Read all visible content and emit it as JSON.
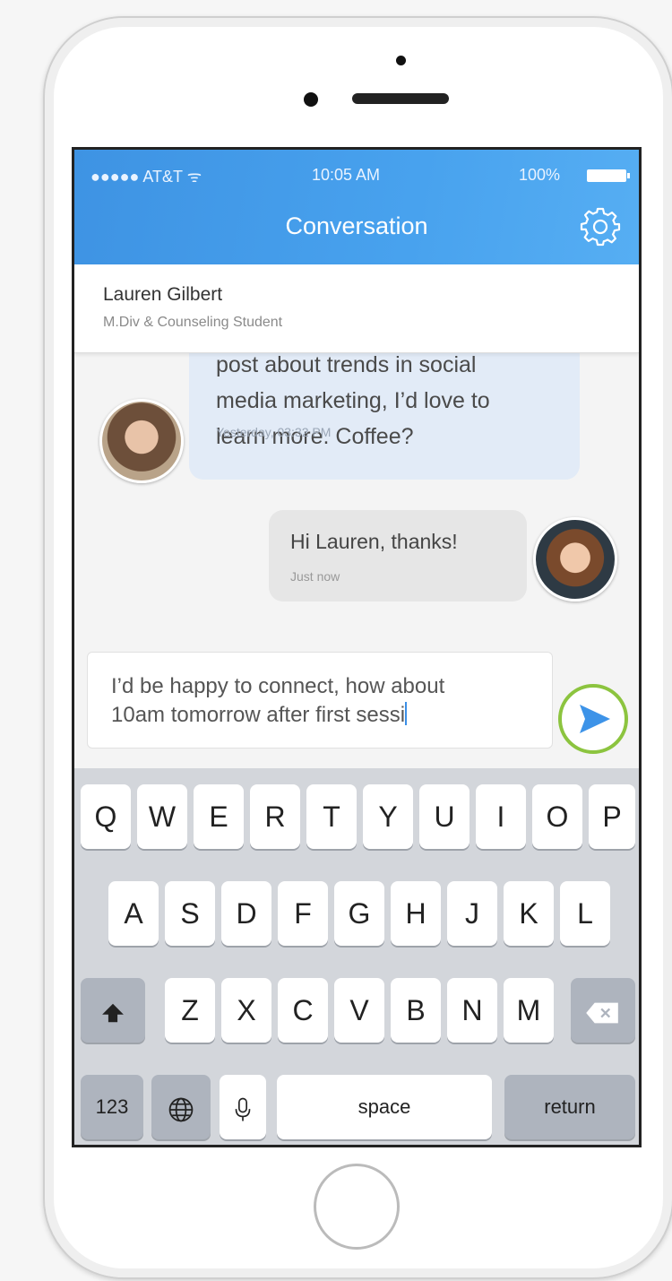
{
  "status_bar": {
    "carrier": "●●●●● AT&T ᯤ",
    "time": "10:05 AM",
    "battery": "100%"
  },
  "nav": {
    "title": "Conversation",
    "settings_icon": "gear-icon"
  },
  "contact": {
    "name": "Lauren Gilbert",
    "subtitle": "M.Div & Counseling Student"
  },
  "messages": [
    {
      "sender": "Lauren Gilbert",
      "text_lines": [
        "post about trends in social",
        "media marketing, I’d love to",
        "learn more. Coffee?"
      ],
      "timestamp": "Yesterday, 03:32 PM"
    },
    {
      "sender": "me",
      "text": "Hi Lauren, thanks!",
      "timestamp": "Just now"
    }
  ],
  "composer": {
    "line1": "I’d be happy to connect, how about",
    "line2": "10am tomorrow after first sessi",
    "send_icon": "send-icon",
    "accent": "#8cc43f"
  },
  "keyboard": {
    "row1": [
      "Q",
      "W",
      "E",
      "R",
      "T",
      "Y",
      "U",
      "I",
      "O",
      "P"
    ],
    "row2": [
      "A",
      "S",
      "D",
      "F",
      "G",
      "H",
      "J",
      "K",
      "L"
    ],
    "row3": [
      "Z",
      "X",
      "C",
      "V",
      "B",
      "N",
      "M"
    ],
    "numbers": "123",
    "space": "space",
    "return": "return"
  },
  "colors": {
    "header": "#4aa0ec",
    "incoming_bubble": "#e2ebf7",
    "outgoing_bubble": "#e6e6e6"
  }
}
